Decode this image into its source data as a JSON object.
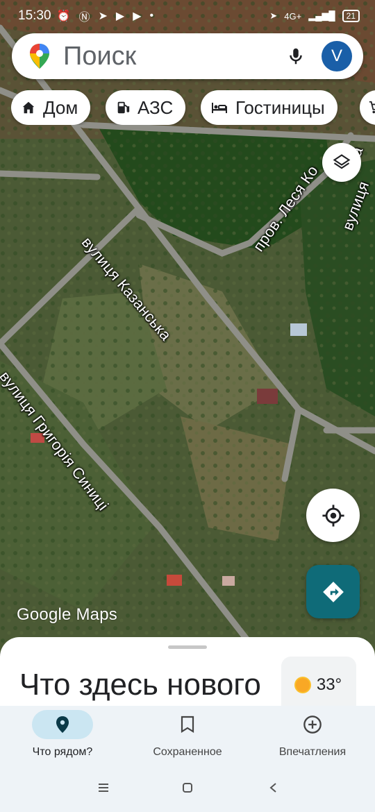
{
  "status_bar": {
    "time": "15:30",
    "network": "4G+",
    "battery": "21"
  },
  "search": {
    "placeholder": "Поиск",
    "avatar_letter": "V"
  },
  "chips": [
    {
      "label": "Дом",
      "icon": "home-icon"
    },
    {
      "label": "АЗС",
      "icon": "gas-station-icon"
    },
    {
      "label": "Гостиницы",
      "icon": "hotel-icon"
    },
    {
      "label": "",
      "icon": "shopping-cart-icon"
    }
  ],
  "map": {
    "street_labels": {
      "kazanska": "вулиця Казанська",
      "lesya": "пров. Леся Ко",
      "vulytsia_right": "вулиця",
      "hryhoriia": "вулиця Григорія Синиці",
      "sa": "са"
    },
    "attribution": "Google Maps"
  },
  "sheet": {
    "title": "Что здесь нового",
    "weather_temp": "33°"
  },
  "bottom_nav": [
    {
      "label": "Что рядом?",
      "icon": "location-pin-icon",
      "active": true
    },
    {
      "label": "Сохраненное",
      "icon": "bookmark-icon",
      "active": false
    },
    {
      "label": "Впечатления",
      "icon": "add-circle-icon",
      "active": false
    }
  ],
  "colors": {
    "accent_teal": "#0f6b78",
    "avatar_blue": "#1a5fa8",
    "active_pill": "#cbe6f2"
  }
}
